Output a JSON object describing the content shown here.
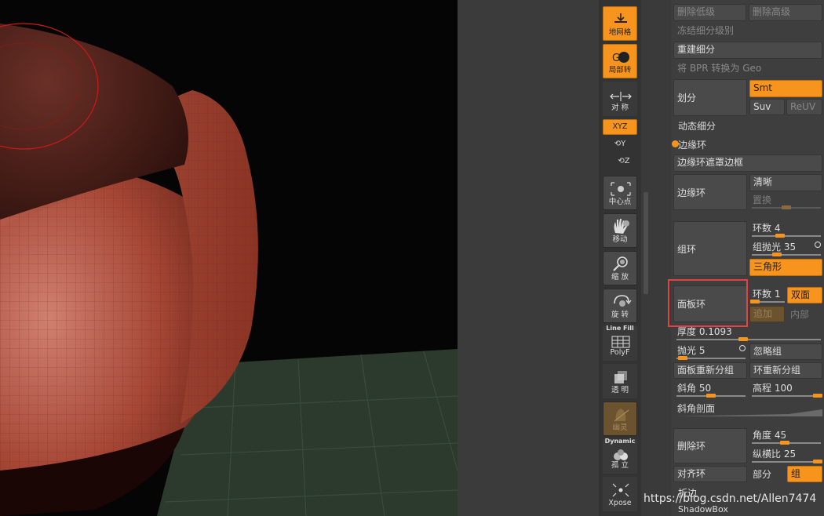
{
  "toolbar": {
    "floor_label": "地网格",
    "local_label": "局部转",
    "symmetry_label": "对 称",
    "xyz_label": "XYZ",
    "y_axis_label": "Y",
    "z_axis_label": "Z",
    "frame_label": "中心点",
    "move_label": "移动",
    "scale_label": "缩 放",
    "rotate_label": "旋 转",
    "linefill_top": "Line Fill",
    "polyf_label": "PolyF",
    "transp_label": "透 明",
    "ghost_label": "幽灵",
    "dynamic_top": "Dynamic",
    "solo_label": "孤 立",
    "xpose_label": "Xpose"
  },
  "panel": {
    "del_lower": "删除低级",
    "del_higher": "删除高级",
    "freeze_subdiv": "冻结细分级别",
    "reconstruct_subdiv": "重建细分",
    "bpr_to_geo": "将 BPR 转换为 Geo",
    "divide": "划分",
    "smt": "Smt",
    "suv": "Suv",
    "reuv": "ReUV",
    "dynamic_subdiv": "动态细分",
    "edge_loop_section": "边缘环",
    "edge_loop_masked_border": "边缘环遮罩边框",
    "edge_loop": "边缘环",
    "crisp": "清晰",
    "displace": "置换",
    "group_loops": "组环",
    "loops_label": "环数 4",
    "polish_label": "组抛光 35",
    "triangles": "三角形",
    "panel_loops": "面板环",
    "panel_loops_count": "环数 1",
    "double": "双面",
    "append": "追加",
    "inner": "内部",
    "thickness": "厚度 0.1093",
    "polish": "抛光 5",
    "ignore_groups": "忽略组",
    "panel_regroup": "面板重新分组",
    "loop_regroup": "环重新分组",
    "bevel": "斜角 50",
    "elevation": "高程 100",
    "bevel_profile": "斜角剖面",
    "delete_loops": "删除环",
    "angle": "角度 45",
    "aspect": "纵横比 25",
    "align_loops": "对齐环",
    "partial": "部分",
    "groups": "组",
    "crease": "折边",
    "shadowbox": "ShadowBox"
  },
  "watermark": "https://blog.csdn.net/Allen7474",
  "colors": {
    "accent": "#f7941d",
    "viewport_bg": "#050505",
    "mesh": "#a8493a",
    "highlight": "#e04343"
  }
}
